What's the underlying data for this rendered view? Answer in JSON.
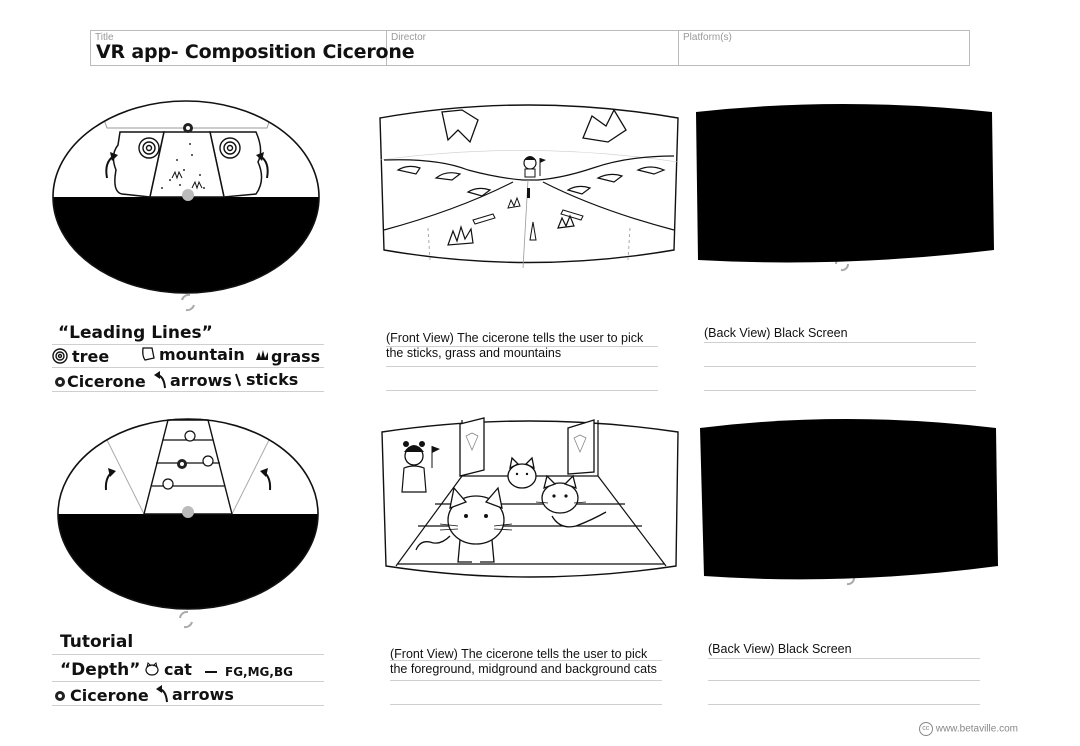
{
  "header": {
    "title_label": "Title",
    "title_value": "VR app- Composition Cicerone",
    "director_label": "Director",
    "platform_label": "Platform(s)"
  },
  "panel1": {
    "legend_line1": "“Leading Lines”",
    "legend_line2_tree": "tree",
    "legend_line2_mountain": "mountain",
    "legend_line2_grass": "grass",
    "legend_line3_cicerone": "Cicerone",
    "legend_line3_arrows": "arrows",
    "legend_line3_sticks": "sticks",
    "front_caption": "(Front View) The cicerone tells the user to pick the sticks, grass and mountains",
    "back_caption": "(Back View) Black Screen"
  },
  "panel2": {
    "legend_line1": "Tutorial",
    "legend_line2_depth": "“Depth”",
    "legend_line2_cat": "cat",
    "legend_line2_layers": "FG,MG,BG",
    "legend_line3_cicerone": "Cicerone",
    "legend_line3_arrows": "arrows",
    "front_caption": "(Front View) The cicerone tells the user to pick the foreground, midground and background cats",
    "back_caption": "(Back View) Black Screen"
  },
  "footer": {
    "credit": "www.betaville.com",
    "cc_mark": "cc"
  },
  "colors": {
    "ink": "#111111",
    "rule": "#cfcfcf",
    "header_border": "#bbbbbb"
  }
}
